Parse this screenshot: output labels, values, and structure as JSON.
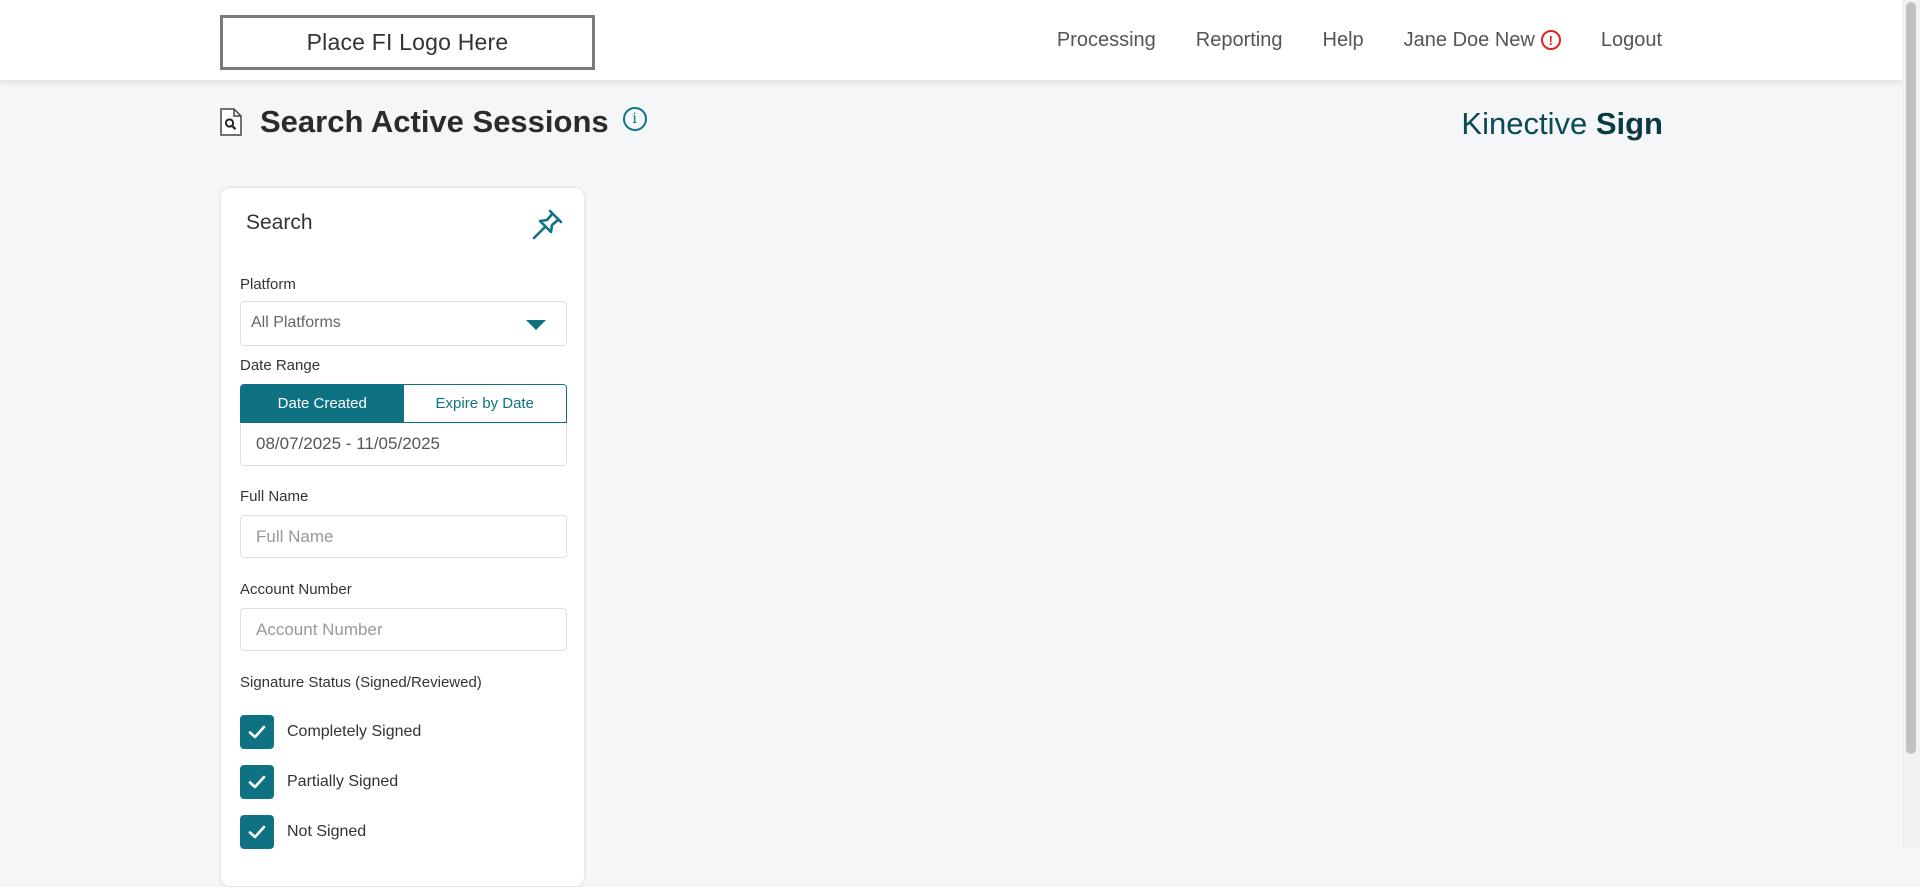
{
  "header": {
    "logo_text": "Place FI Logo Here",
    "nav": {
      "processing": "Processing",
      "reporting": "Reporting",
      "help": "Help",
      "user": "Jane Doe New",
      "logout": "Logout"
    }
  },
  "page": {
    "title": "Search Active Sessions",
    "brand_prefix": "Kinective",
    "brand_suffix": "Sign"
  },
  "search_panel": {
    "title": "Search",
    "platform": {
      "label": "Platform",
      "value": "All Platforms"
    },
    "date_range": {
      "label": "Date Range",
      "tab_created": "Date Created",
      "tab_expire": "Expire by Date",
      "active_tab": "Date Created",
      "value": "08/07/2025 - 11/05/2025"
    },
    "full_name": {
      "label": "Full Name",
      "placeholder": "Full Name"
    },
    "account_number": {
      "label": "Account Number",
      "placeholder": "Account Number"
    },
    "signature_status": {
      "label": "Signature Status (Signed/Reviewed)",
      "options": [
        {
          "label": "Completely Signed",
          "checked": true
        },
        {
          "label": "Partially Signed",
          "checked": true
        },
        {
          "label": "Not Signed",
          "checked": true
        }
      ]
    }
  },
  "colors": {
    "accent": "#0e7283",
    "alert": "#e02424",
    "brand": "#0b4a55",
    "background": "#f5f6f8"
  },
  "icons": {
    "document": "document-search-icon",
    "info": "info-icon",
    "pin": "pin-icon",
    "alert": "alert-icon",
    "caret": "chevron-down-icon",
    "check": "check-icon"
  }
}
